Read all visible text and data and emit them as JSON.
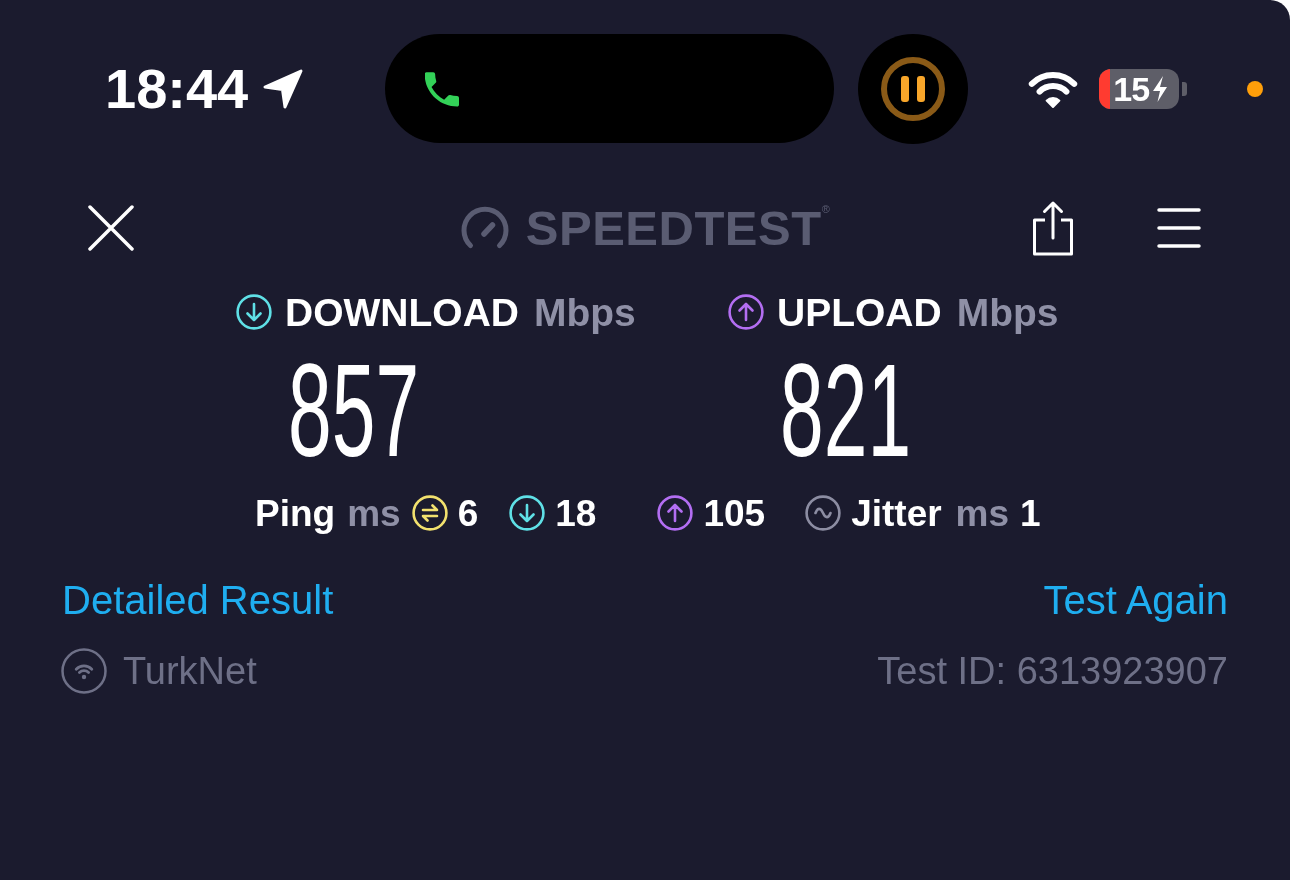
{
  "status_bar": {
    "time": "18:44",
    "battery": "15"
  },
  "toolbar": {
    "logo": "SPEEDTEST$^{®}$"
  },
  "results": [
    {
      "kind": "download",
      "label": "DOWNLOAD",
      "unit": "Mbps",
      "value": "857"
    },
    {
      "kind": "upload",
      "label": "UPLOAD",
      "unit": "Mbps",
      "value": "821"
    }
  ],
  "latency": {
    "label": "Ping",
    "unit": "ms",
    "metrics": [
      {
        "kind": "idle",
        "value": "6"
      },
      {
        "kind": "download",
        "value": "18"
      },
      {
        "kind": "upload",
        "value": "105"
      }
    ]
  },
  "jitter": {
    "label": "Jitter",
    "unit": "ms",
    "value": "1"
  },
  "links": [
    {
      "label": "Detailed Result"
    },
    {
      "label": "Test Again"
    }
  ],
  "footer": {
    "network": "TurkNet",
    "test_id": "Test ID: 6313923907"
  }
}
